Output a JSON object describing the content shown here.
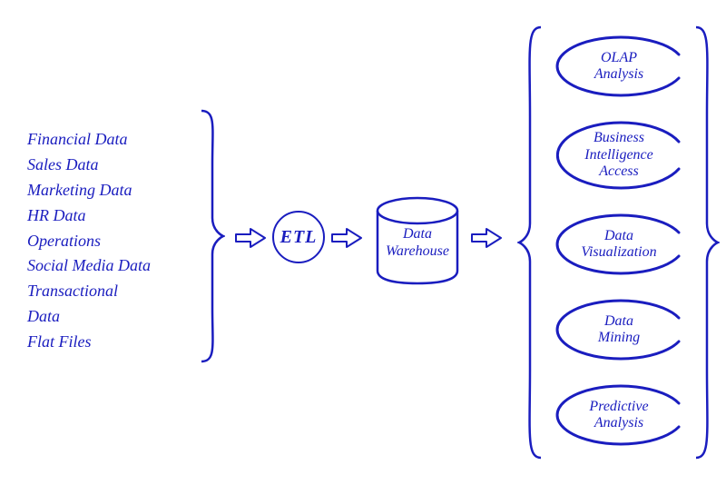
{
  "colors": {
    "ink": "#1a1dbf"
  },
  "sources": [
    "Financial Data",
    "Sales Data",
    "Marketing Data",
    "HR Data",
    "Operations",
    "Social Media Data",
    "Transactional",
    "Data",
    "Flat Files"
  ],
  "etl_label": "ETL",
  "warehouse_label_line1": "Data",
  "warehouse_label_line2": "Warehouse",
  "outputs": [
    {
      "line1": "OLAP",
      "line2": "Analysis"
    },
    {
      "line1": "Business",
      "line2": "Intelligence",
      "line3": "Access"
    },
    {
      "line1": "Data",
      "line2": "Visualization"
    },
    {
      "line1": "Data",
      "line2": "Mining"
    },
    {
      "line1": "Predictive",
      "line2": "Analysis"
    }
  ]
}
